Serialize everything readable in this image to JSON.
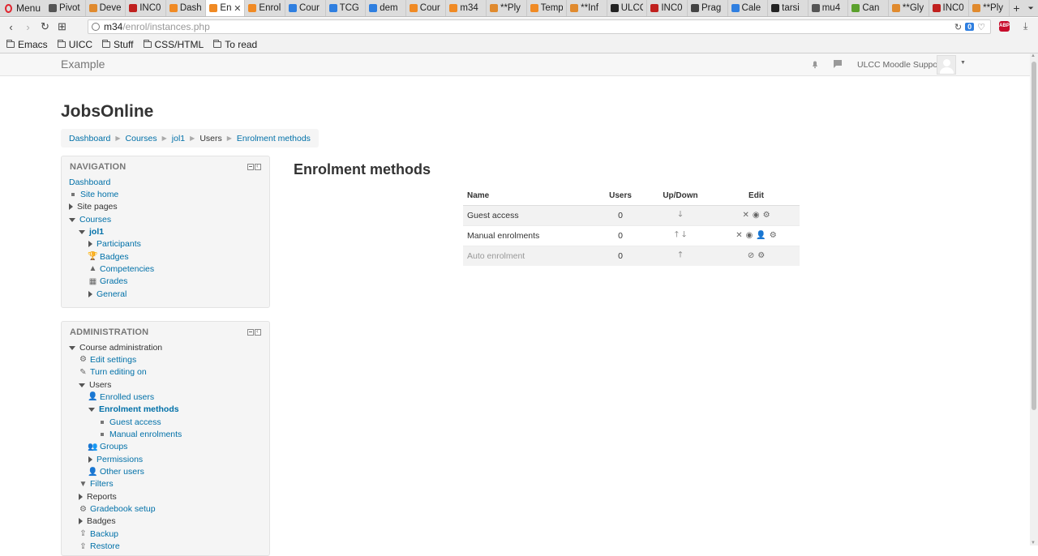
{
  "browser": {
    "menu_label": "Menu",
    "tabs": [
      {
        "title": "Pivot",
        "color": "#555555"
      },
      {
        "title": "Deve",
        "color": "#e08a2e"
      },
      {
        "title": "INC0",
        "color": "#c0201e"
      },
      {
        "title": "Dash",
        "color": "#f08a24"
      },
      {
        "title": "En",
        "color": "#f08a24",
        "active": true
      },
      {
        "title": "Enrol",
        "color": "#f08a24"
      },
      {
        "title": "Cour",
        "color": "#2f7fe0"
      },
      {
        "title": "TCG",
        "color": "#2f7fe0"
      },
      {
        "title": "dem",
        "color": "#2f7fe0"
      },
      {
        "title": "Cour",
        "color": "#f08a24"
      },
      {
        "title": "m34",
        "color": "#f08a24"
      },
      {
        "title": "**Ply",
        "color": "#e08a2e"
      },
      {
        "title": "Temp",
        "color": "#f08a24"
      },
      {
        "title": "**Inf",
        "color": "#e08a2e"
      },
      {
        "title": "ULCC",
        "color": "#222222"
      },
      {
        "title": "INC0",
        "color": "#c0201e"
      },
      {
        "title": "Prag",
        "color": "#444444"
      },
      {
        "title": "Cale",
        "color": "#2f7fe0"
      },
      {
        "title": "tarsi",
        "color": "#222222"
      },
      {
        "title": "mu4",
        "color": "#555555"
      },
      {
        "title": "Can",
        "color": "#5aa02c"
      },
      {
        "title": "**Gly",
        "color": "#e08a2e"
      },
      {
        "title": "INC0",
        "color": "#c0201e"
      },
      {
        "title": "**Ply",
        "color": "#e08a2e"
      }
    ],
    "new_tab_glyph": "+",
    "url_host": "m34",
    "url_path": "/enrol/instances.php",
    "url_badge": "0",
    "bookmarks": [
      "Emacs",
      "UICC",
      "Stuff",
      "CSS/HTML",
      "To read"
    ]
  },
  "header": {
    "site_name": "Example",
    "user_name": "ULCC Moodle Support"
  },
  "page": {
    "title": "JobsOnline",
    "breadcrumb": [
      "Dashboard",
      "Courses",
      "jol1",
      "Users",
      "Enrolment methods"
    ]
  },
  "navigation": {
    "title": "NAVIGATION",
    "items": [
      {
        "label": "Dashboard",
        "level": 0,
        "kind": "none",
        "link": true
      },
      {
        "label": "Site home",
        "level": 1,
        "kind": "bullet",
        "link": true
      },
      {
        "label": "Site pages",
        "level": 1,
        "kind": "collapsed",
        "link": false
      },
      {
        "label": "Courses",
        "level": 1,
        "kind": "expanded",
        "link": true
      },
      {
        "label": "jol1",
        "level": 2,
        "kind": "expanded",
        "link": true,
        "bold": true
      },
      {
        "label": "Participants",
        "level": 3,
        "kind": "collapsed",
        "link": true
      },
      {
        "label": "Badges",
        "level": 3,
        "kind": "icon",
        "icon": "trophy-icon",
        "glyph": "🏆",
        "link": true
      },
      {
        "label": "Competencies",
        "level": 3,
        "kind": "icon",
        "icon": "competency-icon",
        "glyph": "▲",
        "link": true
      },
      {
        "label": "Grades",
        "level": 3,
        "kind": "icon",
        "icon": "grades-table-icon",
        "glyph": "▦",
        "link": true
      },
      {
        "label": "General",
        "level": 3,
        "kind": "collapsed",
        "link": true
      }
    ]
  },
  "administration": {
    "title": "ADMINISTRATION",
    "items": [
      {
        "label": "Course administration",
        "level": 1,
        "kind": "expanded",
        "link": false
      },
      {
        "label": "Edit settings",
        "level": 2,
        "kind": "icon",
        "icon": "gear-icon",
        "glyph": "⚙",
        "link": true
      },
      {
        "label": "Turn editing on",
        "level": 2,
        "kind": "icon",
        "icon": "pencil-icon",
        "glyph": "✎",
        "link": true
      },
      {
        "label": "Users",
        "level": 2,
        "kind": "expanded",
        "link": false
      },
      {
        "label": "Enrolled users",
        "level": 3,
        "kind": "icon",
        "icon": "user-icon",
        "glyph": "👤",
        "link": true
      },
      {
        "label": "Enrolment methods",
        "level": 3,
        "kind": "expanded",
        "link": true,
        "bold": true
      },
      {
        "label": "Guest access",
        "level": 4,
        "kind": "bullet",
        "link": true
      },
      {
        "label": "Manual enrolments",
        "level": 4,
        "kind": "bullet",
        "link": true
      },
      {
        "label": "Groups",
        "level": 3,
        "kind": "icon",
        "icon": "group-icon",
        "glyph": "👥",
        "link": true
      },
      {
        "label": "Permissions",
        "level": 3,
        "kind": "collapsed",
        "link": true
      },
      {
        "label": "Other users",
        "level": 3,
        "kind": "icon",
        "icon": "user-icon",
        "glyph": "👤",
        "link": true
      },
      {
        "label": "Filters",
        "level": 2,
        "kind": "icon",
        "icon": "filter-icon",
        "glyph": "▼",
        "link": true
      },
      {
        "label": "Reports",
        "level": 2,
        "kind": "collapsed",
        "link": false
      },
      {
        "label": "Gradebook setup",
        "level": 2,
        "kind": "icon",
        "icon": "gear-icon",
        "glyph": "⚙",
        "link": true
      },
      {
        "label": "Badges",
        "level": 2,
        "kind": "collapsed",
        "link": false
      },
      {
        "label": "Backup",
        "level": 2,
        "kind": "icon",
        "icon": "backup-icon",
        "glyph": "⇪",
        "link": true
      },
      {
        "label": "Restore",
        "level": 2,
        "kind": "icon",
        "icon": "restore-icon",
        "glyph": "⇪",
        "link": true
      }
    ]
  },
  "main": {
    "heading": "Enrolment methods",
    "columns": [
      "Name",
      "Users",
      "Up/Down",
      "Edit"
    ],
    "rows": [
      {
        "name": "Guest access",
        "users": "0",
        "updown": [
          "down"
        ],
        "edit": [
          "delete",
          "hide",
          "settings"
        ],
        "dimmed": false
      },
      {
        "name": "Manual enrolments",
        "users": "0",
        "updown": [
          "up",
          "down"
        ],
        "edit": [
          "delete",
          "hide",
          "enrol-users",
          "settings"
        ],
        "dimmed": false
      },
      {
        "name": "Auto enrolment",
        "users": "0",
        "updown": [
          "up"
        ],
        "edit": [
          "show",
          "settings"
        ],
        "dimmed": true
      }
    ]
  }
}
